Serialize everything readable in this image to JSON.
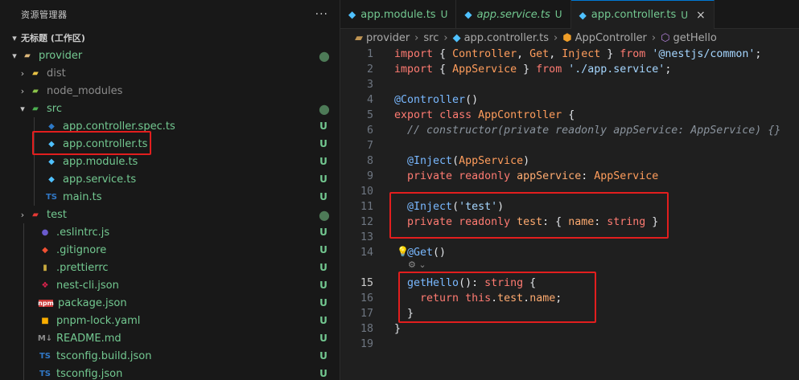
{
  "sidebar": {
    "title": "资源管理器",
    "more": "···",
    "workspace": "无标题 (工作区)",
    "items": [
      {
        "label": "provider",
        "status": "●",
        "icon": "folder-open-icon"
      },
      {
        "label": "dist",
        "status": "",
        "icon": "folder-icon"
      },
      {
        "label": "node_modules",
        "status": "",
        "icon": "node-folder-icon"
      },
      {
        "label": "src",
        "status": "●",
        "icon": "src-folder-icon"
      },
      {
        "label": "app.controller.spec.ts",
        "status": "U",
        "icon": "test-ts-icon"
      },
      {
        "label": "app.controller.ts",
        "status": "U",
        "icon": "nest-controller-icon"
      },
      {
        "label": "app.module.ts",
        "status": "U",
        "icon": "nest-module-icon"
      },
      {
        "label": "app.service.ts",
        "status": "U",
        "icon": "nest-service-icon"
      },
      {
        "label": "main.ts",
        "status": "U",
        "icon": "ts-icon",
        "icon_text": "TS"
      },
      {
        "label": "test",
        "status": "●",
        "icon": "test-folder-icon"
      },
      {
        "label": ".eslintrc.js",
        "status": "U",
        "icon": "eslint-icon"
      },
      {
        "label": ".gitignore",
        "status": "U",
        "icon": "git-icon"
      },
      {
        "label": ".prettierrc",
        "status": "U",
        "icon": "prettier-icon"
      },
      {
        "label": "nest-cli.json",
        "status": "U",
        "icon": "nest-icon"
      },
      {
        "label": "package.json",
        "status": "U",
        "icon": "npm-icon",
        "icon_text": "npm"
      },
      {
        "label": "pnpm-lock.yaml",
        "status": "U",
        "icon": "pnpm-icon"
      },
      {
        "label": "README.md",
        "status": "U",
        "icon": "markdown-icon",
        "icon_text": "M↓"
      },
      {
        "label": "tsconfig.build.json",
        "status": "U",
        "icon": "tsconfig-icon",
        "icon_text": "TS"
      },
      {
        "label": "tsconfig.json",
        "status": "U",
        "icon": "tsconfig-icon",
        "icon_text": "TS"
      }
    ]
  },
  "tabs": [
    {
      "label": "app.module.ts",
      "status": "U",
      "icon": "nest-module-icon"
    },
    {
      "label": "app.service.ts",
      "status": "U",
      "icon": "nest-service-icon"
    },
    {
      "label": "app.controller.ts",
      "status": "U",
      "icon": "nest-controller-icon",
      "close": "×"
    }
  ],
  "breadcrumb": [
    "provider",
    "src",
    "app.controller.ts",
    "AppController",
    "getHello"
  ],
  "code": {
    "line_numbers": [
      "1",
      "2",
      "3",
      "4",
      "5",
      "6",
      "7",
      "8",
      "9",
      "10",
      "11",
      "12",
      "13",
      "14",
      "15",
      "16",
      "17",
      "18",
      "19"
    ],
    "current_line": "15",
    "lines": [
      "import { Controller, Get, Inject } from '@nestjs/common';",
      "import { AppService } from './app.service';",
      "",
      "@Controller()",
      "export class AppController {",
      "  // constructor(private readonly appService: AppService) {}",
      "",
      "  @Inject(AppService)",
      "  private readonly appService: AppService",
      "",
      "  @Inject('test')",
      "  private readonly test: { name: string }",
      "",
      "  @Get()",
      "  getHello(): string {",
      "    return this.test.name;",
      "  }",
      "}",
      ""
    ]
  },
  "colors": {
    "highlight_box": "#e21e1e",
    "untracked": "#73c991",
    "accent": "#0078d4"
  }
}
